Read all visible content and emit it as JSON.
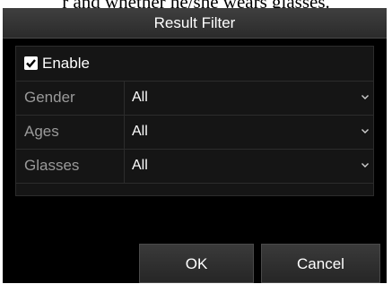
{
  "caption": "r and whether he/she wears glasses.",
  "dialog": {
    "title": "Result Filter",
    "enable": {
      "label": "Enable",
      "checked": true
    },
    "filters": [
      {
        "label": "Gender",
        "value": "All"
      },
      {
        "label": "Ages",
        "value": "All"
      },
      {
        "label": "Glasses",
        "value": "All"
      }
    ],
    "buttons": {
      "ok": "OK",
      "cancel": "Cancel"
    }
  }
}
